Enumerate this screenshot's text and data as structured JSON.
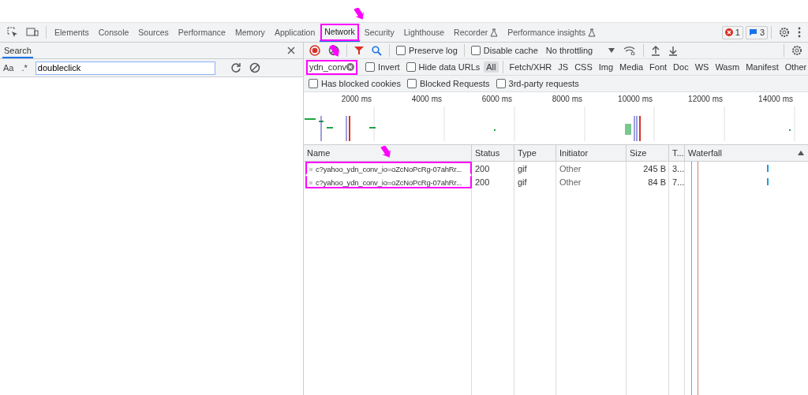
{
  "tabs": [
    {
      "label": "Elements",
      "selected": false,
      "flask": false
    },
    {
      "label": "Console",
      "selected": false,
      "flask": false
    },
    {
      "label": "Sources",
      "selected": false,
      "flask": false
    },
    {
      "label": "Performance",
      "selected": false,
      "flask": false
    },
    {
      "label": "Memory",
      "selected": false,
      "flask": false
    },
    {
      "label": "Application",
      "selected": false,
      "flask": false
    },
    {
      "label": "Network",
      "selected": true,
      "flask": false,
      "annotated": true
    },
    {
      "label": "Security",
      "selected": false,
      "flask": false
    },
    {
      "label": "Lighthouse",
      "selected": false,
      "flask": false
    },
    {
      "label": "Recorder",
      "selected": false,
      "flask": true
    },
    {
      "label": "Performance insights",
      "selected": false,
      "flask": true
    }
  ],
  "errors": "1",
  "messages": "3",
  "search_panel": {
    "title": "Search",
    "match_case": "Aa",
    "regex": ".*",
    "query": "doubleclick"
  },
  "toolbar": {
    "preserve_log": {
      "label": "Preserve log",
      "checked": false
    },
    "disable_cache": {
      "label": "Disable cache",
      "checked": false
    },
    "throttling": "No throttling"
  },
  "filter": {
    "value": "ydn_conv",
    "annotated": true,
    "invert": {
      "label": "Invert",
      "checked": false
    },
    "hide_data_urls": {
      "label": "Hide data URLs",
      "checked": false
    },
    "types": [
      {
        "label": "All",
        "selected": true
      },
      {
        "label": "Fetch/XHR",
        "selected": false
      },
      {
        "label": "JS",
        "selected": false
      },
      {
        "label": "CSS",
        "selected": false
      },
      {
        "label": "Img",
        "selected": false
      },
      {
        "label": "Media",
        "selected": false
      },
      {
        "label": "Font",
        "selected": false
      },
      {
        "label": "Doc",
        "selected": false
      },
      {
        "label": "WS",
        "selected": false
      },
      {
        "label": "Wasm",
        "selected": false
      },
      {
        "label": "Manifest",
        "selected": false
      },
      {
        "label": "Other",
        "selected": false
      }
    ],
    "options": [
      {
        "label": "Has blocked cookies",
        "checked": false
      },
      {
        "label": "Blocked Requests",
        "checked": false
      },
      {
        "label": "3rd-party requests",
        "checked": false
      }
    ]
  },
  "overview_ticks": [
    "2000 ms",
    "4000 ms",
    "6000 ms",
    "8000 ms",
    "10000 ms",
    "12000 ms",
    "14000 ms"
  ],
  "table": {
    "columns": [
      "Name",
      "Status",
      "Type",
      "Initiator",
      "Size",
      "T...",
      "Waterfall"
    ],
    "rows": [
      {
        "name": "c?yahoo_ydn_conv_io=oZcNoPcRg-07ahRr...",
        "status": "200",
        "type": "gif",
        "initiator": "Other",
        "size": "245 B",
        "time": "3...",
        "annotated": true
      },
      {
        "name": "c?yahoo_ydn_conv_io=oZcNoPcRg-07ahRr...",
        "status": "200",
        "type": "gif",
        "initiator": "Other",
        "size": "84 B",
        "time": "7...",
        "annotated": true
      }
    ]
  }
}
